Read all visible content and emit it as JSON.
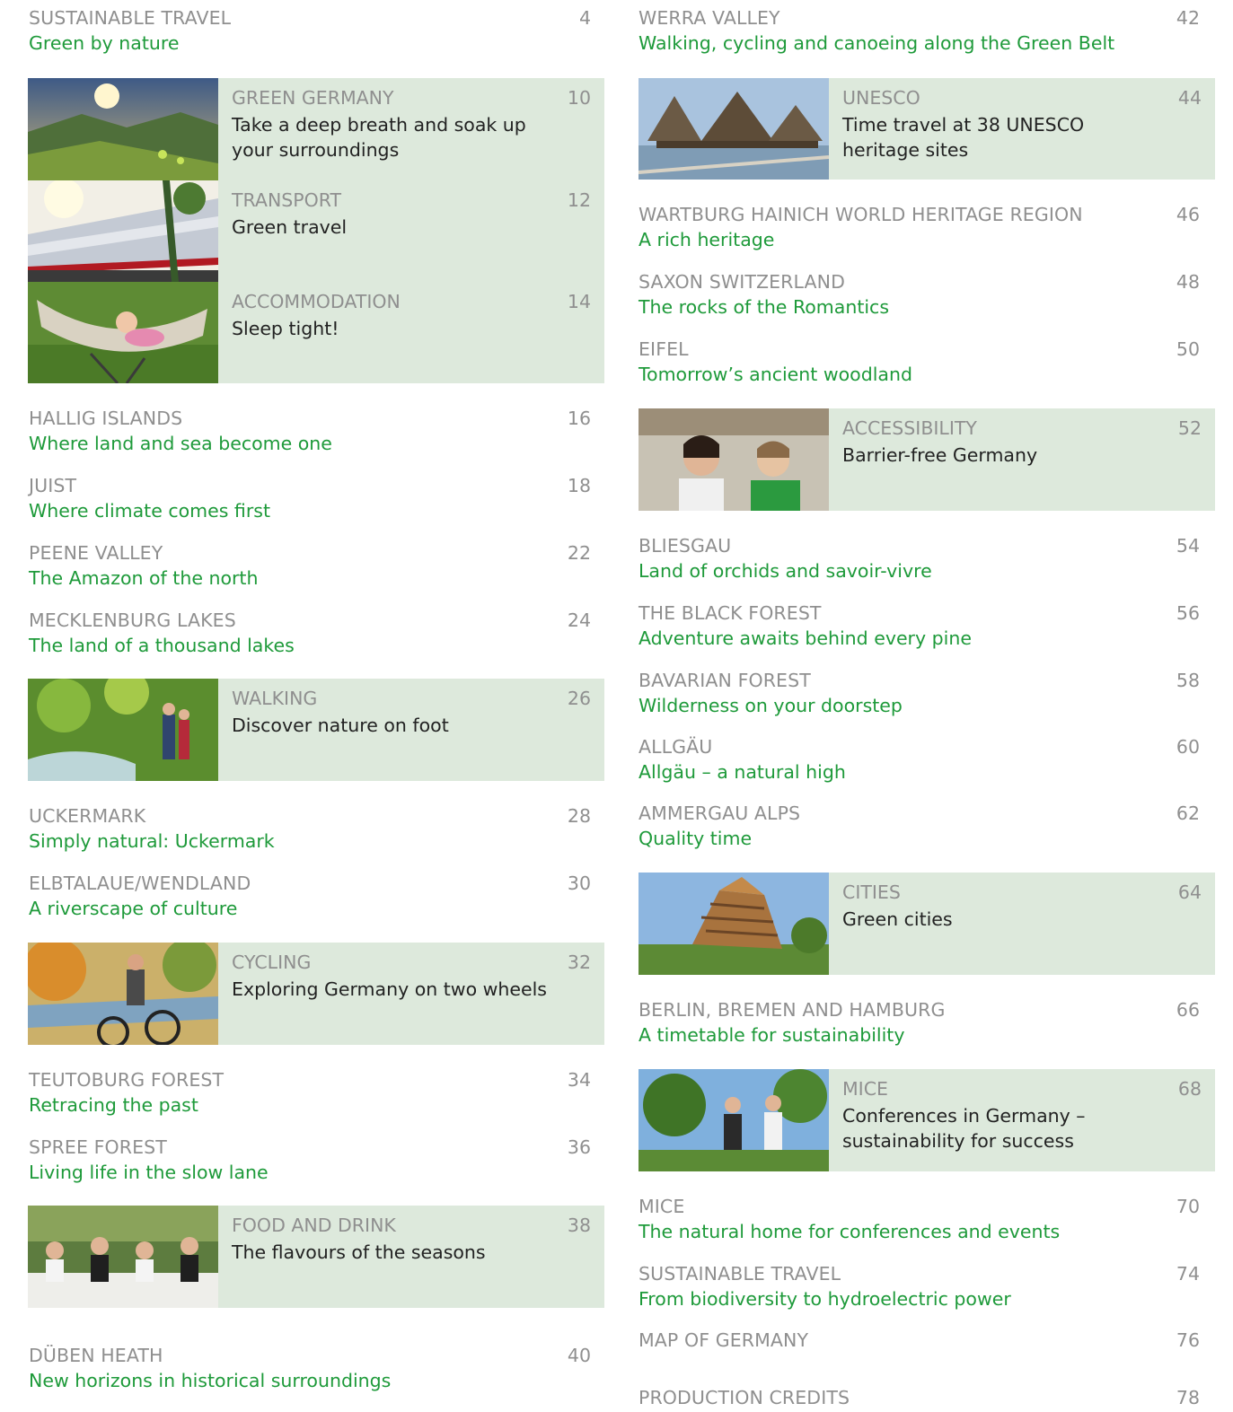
{
  "left_column": {
    "intro": {
      "category": "SUSTAINABLE TRAVEL",
      "title": "Green by nature",
      "page": "4"
    },
    "feature_panel_1": [
      {
        "category": "GREEN GERMANY",
        "title": "Take a deep breath and soak up your surroundings",
        "page": "10",
        "image": "mountain-sunrise-photo"
      },
      {
        "category": "TRANSPORT",
        "title": "Green travel",
        "page": "12",
        "image": "train-photo"
      },
      {
        "category": "ACCOMMODATION",
        "title": "Sleep tight!",
        "page": "14",
        "image": "hammock-child-photo"
      }
    ],
    "group_1": [
      {
        "category": "HALLIG ISLANDS",
        "title": "Where land and sea become one",
        "page": "16"
      },
      {
        "category": "JUIST",
        "title": "Where climate comes first",
        "page": "18"
      },
      {
        "category": "PEENE VALLEY",
        "title": "The Amazon of the north",
        "page": "22"
      },
      {
        "category": "MECKLENBURG LAKES",
        "title": "The land of a thousand lakes",
        "page": "24"
      }
    ],
    "walking": {
      "category": "WALKING",
      "title": "Discover nature on foot",
      "page": "26",
      "image": "hikers-stream-photo"
    },
    "group_2": [
      {
        "category": "UCKERMARK",
        "title": "Simply natural: Uckermark",
        "page": "28"
      },
      {
        "category": "ELBTALAUE/WENDLAND",
        "title": "A riverscape of culture",
        "page": "30"
      }
    ],
    "cycling": {
      "category": "CYCLING",
      "title": "Exploring Germany on two wheels",
      "page": "32",
      "image": "mountain-biker-photo"
    },
    "group_3": [
      {
        "category": "TEUTOBURG FOREST",
        "title": "Retracing the past",
        "page": "34"
      },
      {
        "category": "SPREE FOREST",
        "title": "Living life in the slow lane",
        "page": "36"
      }
    ],
    "food": {
      "category": "FOOD AND DRINK",
      "title": "The flavours of the seasons",
      "page": "38",
      "image": "outdoor-dining-photo"
    },
    "last": {
      "category": "DÜBEN HEATH",
      "title": "New horizons in historical surroundings",
      "page": "40"
    }
  },
  "right_column": {
    "intro": {
      "category": "WERRA VALLEY",
      "title": "Walking, cycling and canoeing along the Green Belt",
      "page": "42"
    },
    "unesco": {
      "category": "UNESCO",
      "title": "Time travel at 38 UNESCO heritage sites",
      "page": "44",
      "image": "stilt-houses-photo"
    },
    "group_1": [
      {
        "category": "WARTBURG HAINICH WORLD HERITAGE REGION",
        "title": "A rich heritage",
        "page": "46"
      },
      {
        "category": "SAXON SWITZERLAND",
        "title": "The rocks of the Romantics",
        "page": "48"
      },
      {
        "category": "EIFEL",
        "title": "Tomorrow’s ancient woodland",
        "page": "50"
      }
    ],
    "accessibility": {
      "category": "ACCESSIBILITY",
      "title": "Barrier-free Germany",
      "page": "52",
      "image": "two-women-signing-photo"
    },
    "group_2": [
      {
        "category": "BLIESGAU",
        "title": "Land of orchids and savoir-vivre",
        "page": "54"
      },
      {
        "category": "THE BLACK FOREST",
        "title": "Adventure awaits behind every pine",
        "page": "56"
      },
      {
        "category": "BAVARIAN FOREST",
        "title": "Wilderness on your doorstep",
        "page": "58"
      },
      {
        "category": "ALLGÄU",
        "title": "Allgäu – a natural high",
        "page": "60"
      },
      {
        "category": "AMMERGAU ALPS",
        "title": "Quality time",
        "page": "62"
      }
    ],
    "cities": {
      "category": "CITIES",
      "title": "Green cities",
      "page": "64",
      "image": "wooden-tower-photo"
    },
    "group_3": [
      {
        "category": "BERLIN, BREMEN AND HAMBURG",
        "title": "A timetable for sustainability",
        "page": "66"
      }
    ],
    "mice_panel": {
      "category": "MICE",
      "title": "Conferences in Germany – sustainability for success",
      "page": "68",
      "image": "business-people-outdoors-photo"
    },
    "group_4": [
      {
        "category": "MICE",
        "title": "The natural home for conferences and events",
        "page": "70"
      },
      {
        "category": "SUSTAINABLE TRAVEL",
        "title": "From biodiversity to hydroelectric power",
        "page": "74"
      },
      {
        "category": "MAP OF GERMANY",
        "title": "",
        "page": "76"
      }
    ],
    "last": {
      "category": "PRODUCTION CREDITS",
      "title": "",
      "page": "78"
    }
  },
  "colors": {
    "panel_bg": "#dde9dc",
    "category_gray": "#8f8f8f",
    "title_green": "#1e9a3a",
    "panel_title": "#222222"
  }
}
